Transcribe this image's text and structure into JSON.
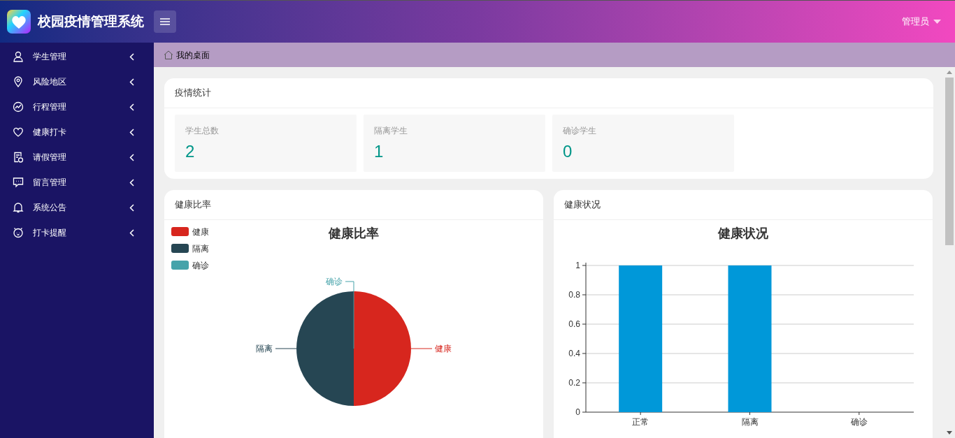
{
  "header": {
    "title": "校园疫情管理系统",
    "user": "管理员"
  },
  "sidebar": {
    "items": [
      {
        "label": "学生管理"
      },
      {
        "label": "风险地区"
      },
      {
        "label": "行程管理"
      },
      {
        "label": "健康打卡"
      },
      {
        "label": "请假管理"
      },
      {
        "label": "留言管理"
      },
      {
        "label": "系统公告"
      },
      {
        "label": "打卡提醒"
      }
    ]
  },
  "breadcrumb": "我的桌面",
  "stats_card": {
    "title": "疫情统计",
    "stats": [
      {
        "label": "学生总数",
        "value": "2"
      },
      {
        "label": "隔离学生",
        "value": "1"
      },
      {
        "label": "确诊学生",
        "value": "0"
      }
    ]
  },
  "ratio_card": {
    "title": "健康比率",
    "legend": [
      {
        "label": "健康",
        "color": "#d7261e"
      },
      {
        "label": "隔离",
        "color": "#264653"
      },
      {
        "label": "确诊",
        "color": "#46a3aa"
      }
    ],
    "chart_data": {
      "type": "pie",
      "title": "健康比率",
      "categories": [
        "健康",
        "隔离",
        "确诊"
      ],
      "values": [
        50,
        50,
        0
      ]
    }
  },
  "status_card": {
    "title": "健康状况",
    "chart_data": {
      "type": "bar",
      "title": "健康状况",
      "categories": [
        "正常",
        "隔离",
        "确诊"
      ],
      "series": [
        {
          "color": "#0098d9",
          "values": [
            1,
            1,
            0
          ]
        }
      ],
      "ylim": [
        0,
        1
      ],
      "yticks": [
        0,
        0.2,
        0.4,
        0.6,
        0.8,
        1
      ],
      "grid": true
    }
  }
}
